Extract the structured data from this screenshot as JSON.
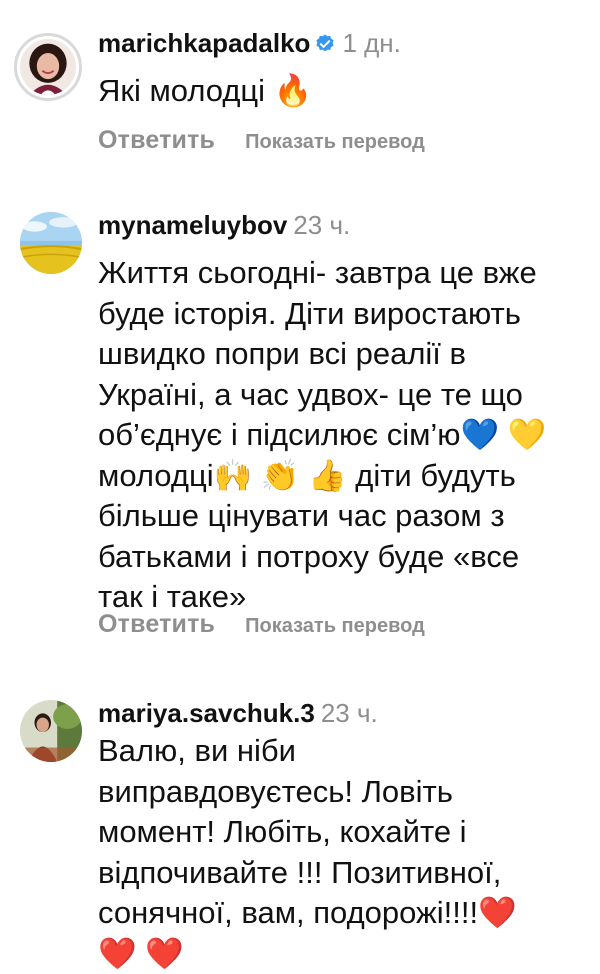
{
  "comments": [
    {
      "username": "marichkapadalko",
      "verified": true,
      "time": "1 дн.",
      "text": "Які молодці 🔥",
      "reply_label": "Ответить",
      "translate_label": "Показать перевод"
    },
    {
      "username": "mynameluybov",
      "verified": false,
      "time": "23 ч.",
      "text": "Життя сьогодні- завтра це вже\nбуде історія. Діти виростають\nшвидко попри всі реалії в\nУкраїні, а час удвох- це те що\nоб’єднує і підсилює сім’ю💙 💛\nмолодці🙌 👏 👍 діти будуть\nбільше цінувати час разом з\nбатьками і потроху буде «все\nтак і таке»",
      "reply_label": "Ответить",
      "translate_label": "Показать перевод"
    },
    {
      "username": "mariya.savchuk.3",
      "verified": false,
      "time": "23 ч.",
      "text": "Валю, ви ніби\nвиправдовуєтесь! Ловіть\nмомент! Любіть, кохайте і\nвідпочивайте !!! Позитивної,\nсонячної, вам, подорожі!!!!❤️\n❤️ ❤️",
      "reply_label": "",
      "translate_label": ""
    }
  ],
  "colors": {
    "text": "#111111",
    "muted": "#8e8e8e",
    "verified_badge": "#3797f0",
    "story_ring": "#d9d9d9"
  },
  "icons": {
    "verified": "verified-badge-icon"
  }
}
